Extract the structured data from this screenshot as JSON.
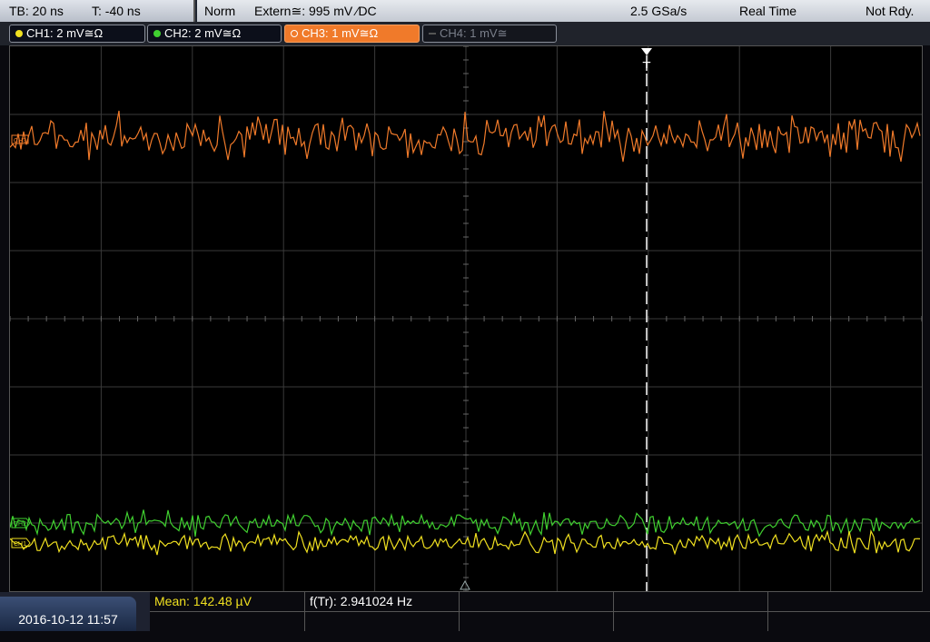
{
  "status": {
    "tb": "TB: 20 ns",
    "t": "T: -40 ns",
    "mode": "Norm",
    "trigger": "Extern≅: 995 mV ⁄DC",
    "rate": "2.5 GSa/s",
    "acq": "Real Time",
    "state": "Not Rdy."
  },
  "channels": [
    {
      "label": "CH1: 2 mV≅Ω",
      "color": "#f0e020"
    },
    {
      "label": "CH2: 2 mV≅Ω",
      "color": "#40d030"
    },
    {
      "label": "CH3: 1 mV≅Ω",
      "color": "#f07a2a"
    },
    {
      "label": "CH4: 1 mV≅",
      "color": "#666a72"
    }
  ],
  "markers": {
    "trigger": "T",
    "ch3": "CH3",
    "ch2": "CH2",
    "ch1": "CH1"
  },
  "bottom": {
    "datetime": "2016-10-12 11:57",
    "mean": "Mean: 142.48 µV",
    "freq": "f(Tr): 2.941024 Hz"
  },
  "colors": {
    "ch1": "#f0e020",
    "ch2": "#40d030",
    "ch3": "#f07a2a",
    "grid": "#3a3a3a"
  }
}
